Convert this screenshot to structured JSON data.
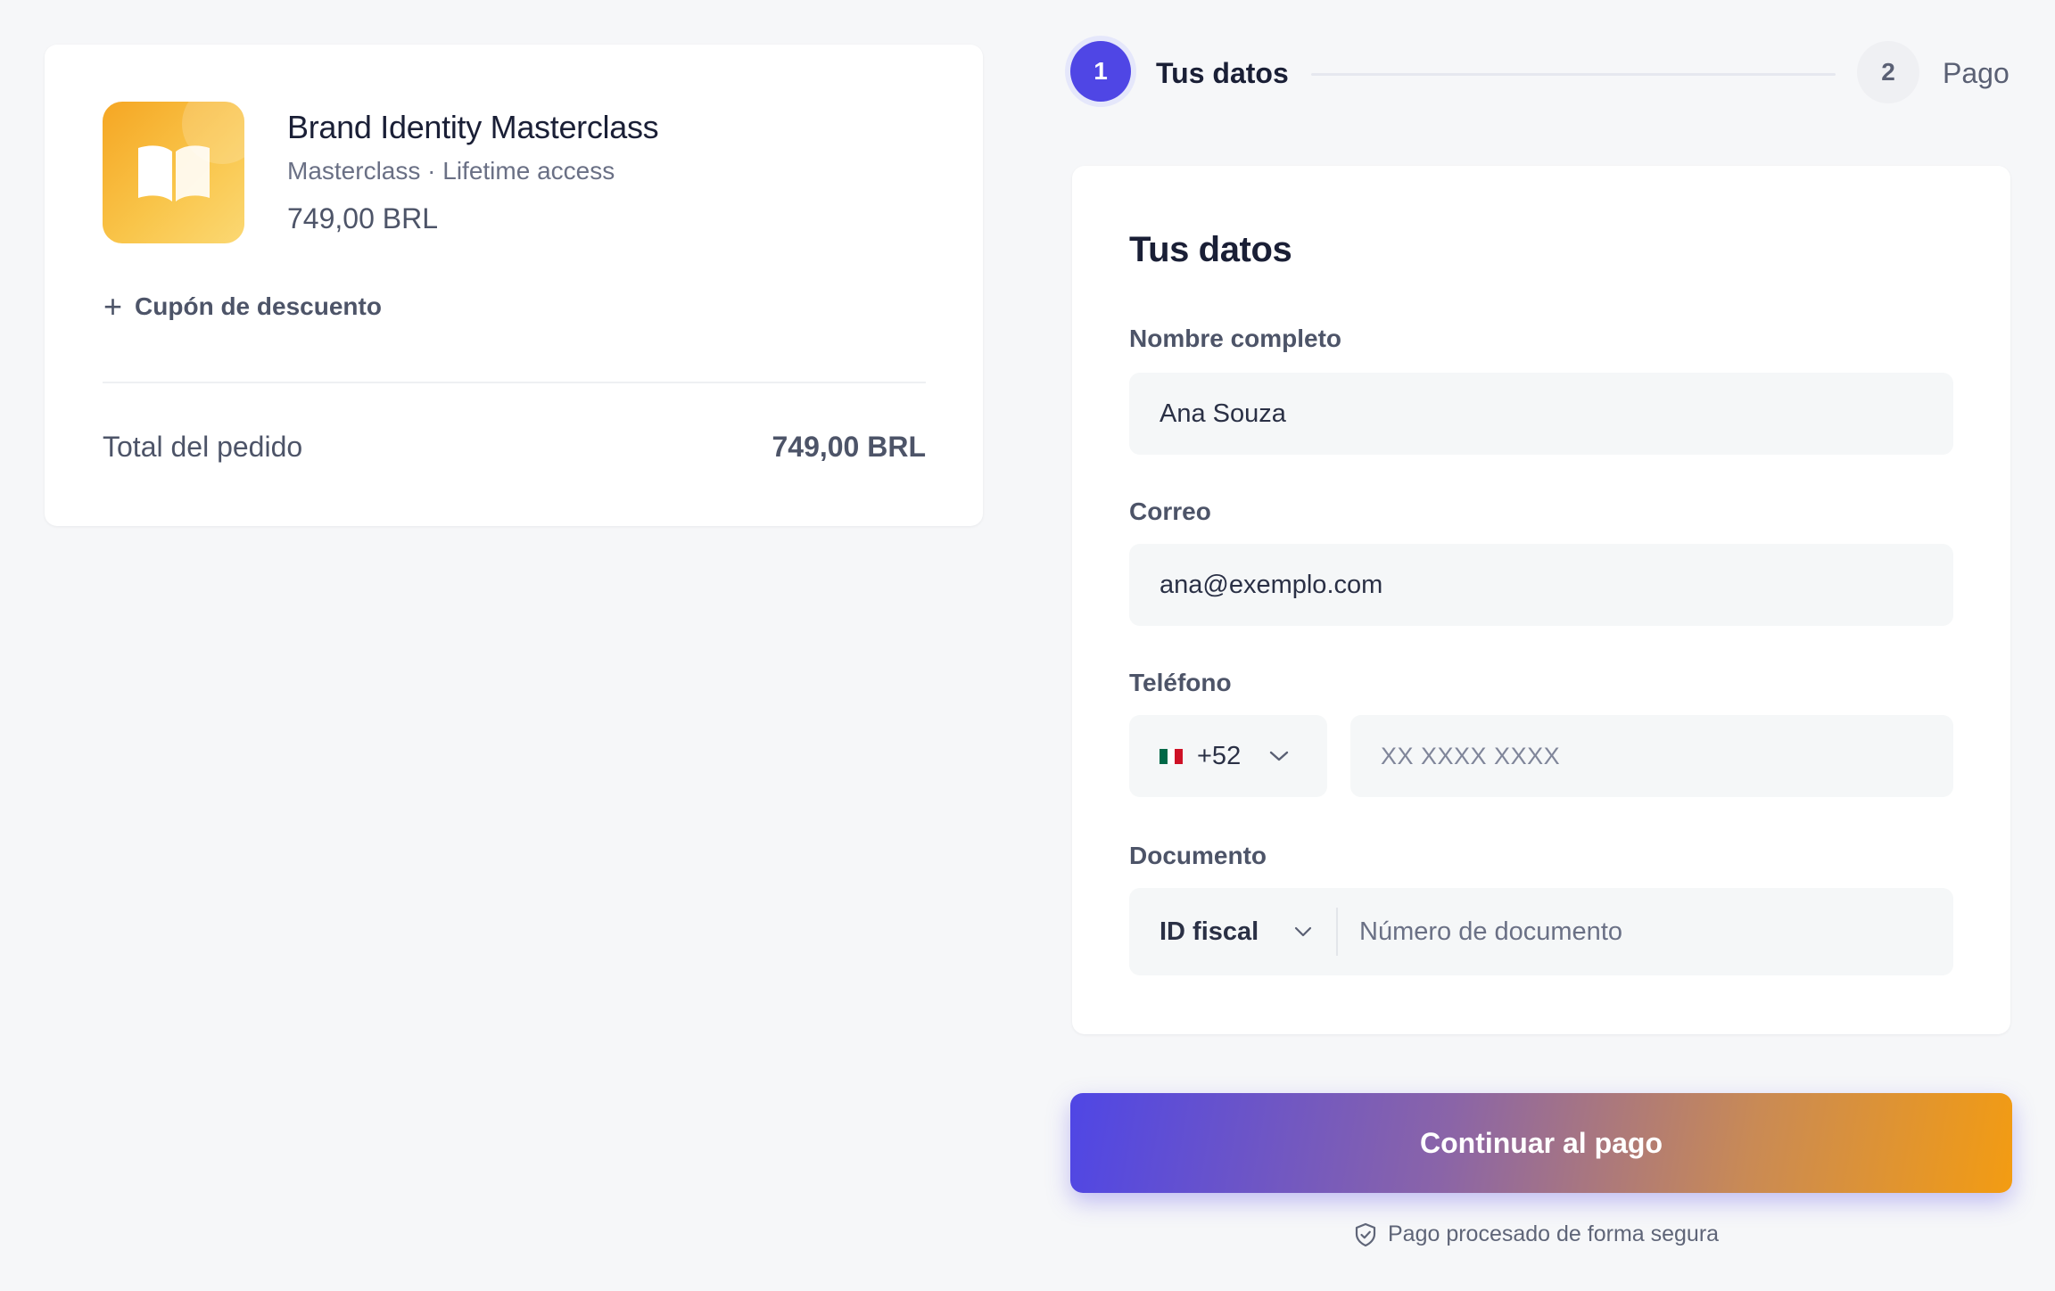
{
  "summary": {
    "product_title": "Brand Identity Masterclass",
    "product_meta": "Masterclass · Lifetime access",
    "product_price": "749,00 BRL",
    "coupon_label": "Cupón de descuento",
    "total_label": "Total del pedido",
    "total_value": "749,00 BRL"
  },
  "stepper": {
    "steps": [
      {
        "number": "1",
        "label": "Tus datos",
        "active": true
      },
      {
        "number": "2",
        "label": "Pago",
        "active": false
      }
    ]
  },
  "form": {
    "title": "Tus datos",
    "name_label": "Nombre completo",
    "name_value": "Ana Souza",
    "email_label": "Correo",
    "email_value": "ana@exemplo.com",
    "phone_label": "Teléfono",
    "phone_code": "+52",
    "phone_country_flag": "mexico-flag",
    "phone_placeholder": "XX XXXX XXXX",
    "document_label": "Documento",
    "document_type": "ID fiscal",
    "document_placeholder": "Número de documento"
  },
  "cta": {
    "label": "Continuar al pago",
    "secure_note": "Pago procesado de forma segura"
  },
  "colors": {
    "accent": "#4f46e5",
    "gradient_end": "#f39c12",
    "thumbnail": "#f5a623"
  }
}
